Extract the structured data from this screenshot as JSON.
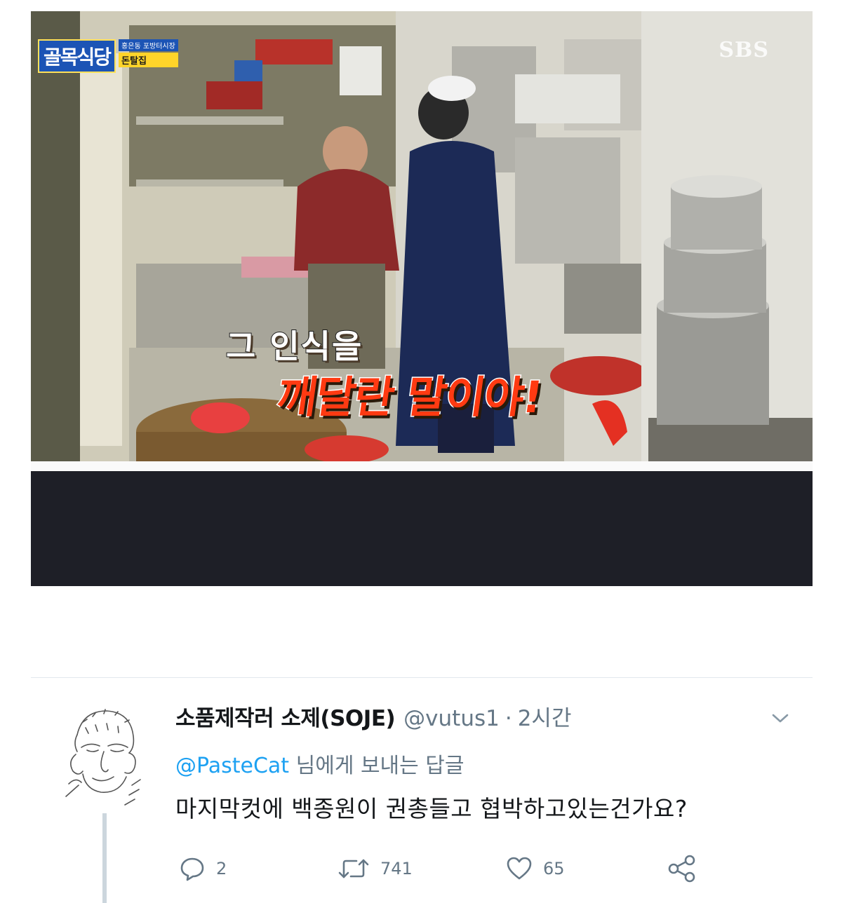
{
  "media": {
    "show_logo": "골목식당",
    "show_tag_location": "홍은동 포방터시장",
    "show_tag_store": "돈탈집",
    "broadcaster": "SBS",
    "caption_line1": "그 인식을",
    "caption_line2": "깨달란 말이야!"
  },
  "tweet": {
    "display_name": "소품제작러 소제(SOJE)",
    "handle": "@vutus1",
    "separator": "·",
    "time": "2시간",
    "reply_to_mention": "@PasteCat",
    "reply_to_suffix": " 님에게 보내는 답글",
    "text": "마지막컷에 백종원이 권총들고 협박하고있는건가요?",
    "counts": {
      "reply": "2",
      "retweet": "741",
      "like": "65"
    }
  },
  "icons": {
    "reply": "reply-bubble-icon",
    "retweet": "retweet-arrows-icon",
    "like": "heart-icon",
    "share": "share-nodes-icon",
    "menu": "chevron-down-icon"
  },
  "colors": {
    "text_primary": "#14171a",
    "text_secondary": "#657786",
    "link": "#1da1f2",
    "caption_red": "#ff3a12",
    "media_dark": "#1e1f27"
  }
}
